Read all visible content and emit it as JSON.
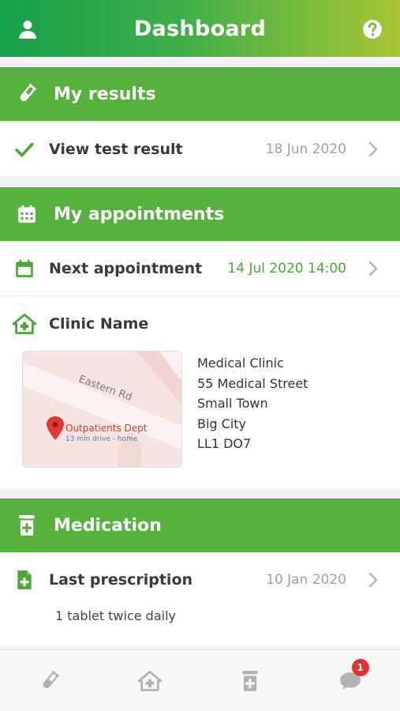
{
  "header": {
    "title": "Dashboard",
    "left_icon": "user-icon",
    "right_icon": "help-icon"
  },
  "results": {
    "title": "My results",
    "icon": "test-tube-icon",
    "item": {
      "label": "View test result",
      "date": "18 Jun 2020",
      "icon": "check-icon"
    }
  },
  "appointments": {
    "title": "My appointments",
    "icon": "calendar-icon",
    "item": {
      "label": "Next appointment",
      "date": "14 Jul 2020 14:00",
      "icon": "calendar-icon"
    },
    "clinic": {
      "name": "Clinic Name",
      "icon": "clinic-icon",
      "map": {
        "road": "Eastern Rd",
        "place": "Outpatients Dept",
        "drive": "13 min drive - home"
      },
      "address": [
        "Medical Clinic",
        "55 Medical Street",
        "Small Town",
        "Big City",
        "LL1 DO7"
      ]
    }
  },
  "medication": {
    "title": "Medication",
    "icon": "medicine-bottle-icon",
    "item": {
      "label": "Last prescription",
      "date": "10 Jan 2020",
      "icon": "prescription-icon"
    },
    "dose": "1 tablet twice daily"
  },
  "tabbar": {
    "tabs": [
      "results-tab",
      "clinic-tab",
      "medication-tab",
      "messages-tab"
    ],
    "messages_badge": "1"
  },
  "colors": {
    "primary_green": "#56b13e",
    "header_gradient_start": "#16a04a",
    "header_gradient_end": "#a8c534",
    "date_green": "#4aa83a",
    "badge_red": "#e8302e"
  }
}
